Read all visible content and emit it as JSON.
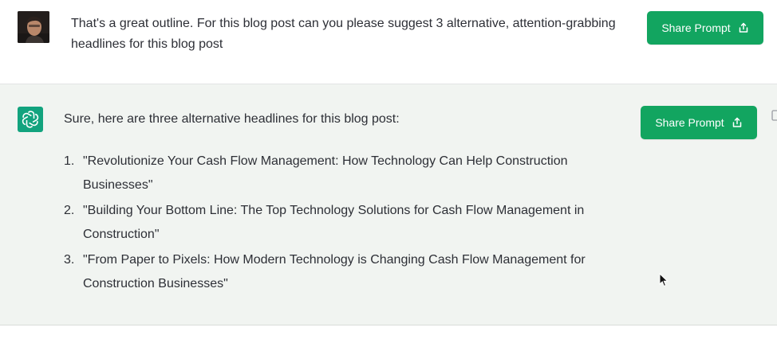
{
  "user_message": {
    "text": "That's a great outline. For this blog post can you please suggest 3 alternative, attention-grabbing headlines for this blog post",
    "avatar_icon": "user-photo-avatar",
    "share_button": {
      "label": "Share Prompt",
      "icon": "share-icon"
    }
  },
  "assistant_message": {
    "avatar_icon": "openai-logo-icon",
    "intro": "Sure, here are three alternative headlines for this blog post:",
    "headlines": [
      {
        "number": "1.",
        "text": "\"Revolutionize Your Cash Flow Management: How Technology Can Help Construction Businesses\""
      },
      {
        "number": "2.",
        "text": "\"Building Your Bottom Line: The Top Technology Solutions for Cash Flow Management in Construction\""
      },
      {
        "number": "3.",
        "text": "\"From Paper to Pixels: How Modern Technology is Changing Cash Flow Management for Construction Businesses\""
      }
    ],
    "share_button": {
      "label": "Share Prompt",
      "icon": "share-icon"
    },
    "copy_icon": "copy-icon"
  },
  "colors": {
    "share_button": "#12a560",
    "assistant_background": "#f1f4f1",
    "openai_avatar": "#12a37e"
  }
}
